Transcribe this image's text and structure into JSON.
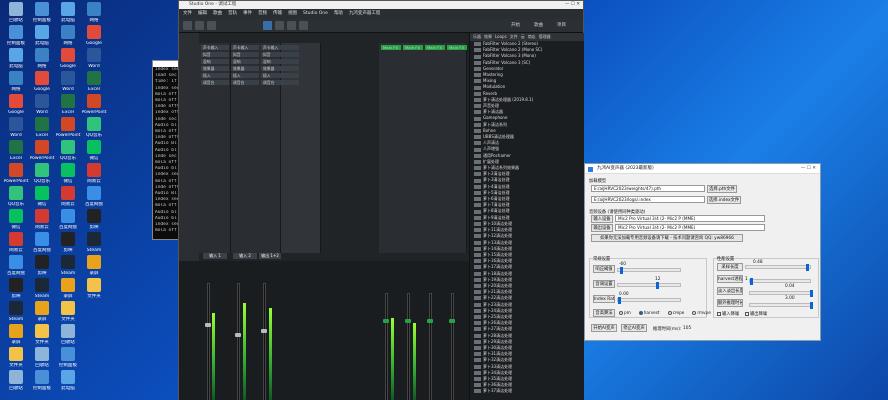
{
  "desktop": {
    "icons": [
      {
        "label": "回收站",
        "color": "#8fb4d9"
      },
      {
        "label": "控制面板",
        "color": "#4a90d9"
      },
      {
        "label": "此电脑",
        "color": "#59a5e6"
      },
      {
        "label": "网络",
        "color": "#3b82c4"
      },
      {
        "label": "Google",
        "color": "#e24a3b"
      },
      {
        "label": "Word",
        "color": "#2b579a"
      },
      {
        "label": "Excel",
        "color": "#217346"
      },
      {
        "label": "PowerPoint",
        "color": "#d24726"
      },
      {
        "label": "QQ音乐",
        "color": "#31c27c"
      },
      {
        "label": "微信",
        "color": "#07c160"
      },
      {
        "label": "网易云",
        "color": "#d33a31"
      },
      {
        "label": "百度网盘",
        "color": "#3a8ee6"
      },
      {
        "label": "剪映",
        "color": "#222222"
      },
      {
        "label": "Steam",
        "color": "#1b2838"
      },
      {
        "label": "录屏",
        "color": "#e8a21c"
      },
      {
        "label": "文件夹",
        "color": "#f3c248"
      }
    ]
  },
  "cmd": {
    "lines": [
      "index sec",
      "load sec",
      "time: 1f",
      "index sec",
      "mola off",
      "mola off",
      "inde offl",
      "index off",
      "inde sec",
      "Audio bl",
      "mola off",
      "inde offl",
      "Audio Bl",
      "Audio bl",
      "inde sec",
      "mola off",
      "Audio bl",
      "index sec",
      "mola off",
      "inde offl",
      "Audio Bl",
      "index sec",
      "mola off",
      "Audio bl",
      "Audio bl",
      "index sec",
      "mola off"
    ]
  },
  "studio": {
    "title": "Studio One - 调试工程",
    "menu": [
      "文件",
      "编辑",
      "歌曲",
      "音轨",
      "事件",
      "音频",
      "传输",
      "视图",
      "Studio One",
      "帮助",
      "九鸿变声器工程"
    ],
    "toolbar_tabs": [
      "开始",
      "歌曲",
      "项目"
    ],
    "left_sends": [
      "声卡输入",
      "拟音",
      "混响",
      "效果器",
      "插入",
      "调音台"
    ],
    "channel_labels": [
      "输入 1",
      "输入 2",
      "输出 1+2"
    ],
    "right_channels": [
      "Main FX",
      "Main FX",
      "Main FX",
      "Main FX"
    ],
    "browser_tabs": [
      "乐器",
      "效果",
      "Loops",
      "文件",
      "云",
      "商店",
      "管理器"
    ],
    "browser_items": [
      "FabFilter Volcano 2 (Stereo)",
      "FabFilter Volcano 2 (Mono SC)",
      "FabFilter Volcano 3 (Mono)",
      "FabFilter Volcano 3 (SC)",
      "Generator",
      "Mastering",
      "Mixing",
      "Modulation",
      "Reverb",
      "萝卜清洁处理器 (2019.8.1)",
      "声音处理",
      "萝卜清洁器",
      "Gamephone",
      "萝卜清洁系列",
      "Bohne",
      "UBBS清洁处理器",
      "人声清洁",
      "人声增强",
      "通用Pochamer",
      "扩展处理",
      "萝卜清洁系列效果器",
      "萝卜2清洁处理",
      "萝卜3清洁处理",
      "萝卜4清洁处理",
      "萝卜5清洁处理",
      "萝卜6清洁处理",
      "萝卜7清洁处理",
      "萝卜8清洁处理",
      "萝卜9清洁处理",
      "萝卜10清洁处理",
      "萝卜11清洁处理",
      "萝卜12清洁处理",
      "萝卜13清洁处理",
      "萝卜14清洁处理",
      "萝卜15清洁处理",
      "萝卜16清洁处理",
      "萝卜17清洁处理",
      "萝卜18清洁处理",
      "萝卜19清洁处理",
      "萝卜20清洁处理",
      "萝卜21清洁处理",
      "萝卜22清洁处理",
      "萝卜23清洁处理",
      "萝卜24清洁处理",
      "萝卜25清洁处理",
      "萝卜26清洁处理",
      "萝卜27清洁处理",
      "萝卜28清洁处理",
      "萝卜29清洁处理",
      "萝卜30清洁处理",
      "萝卜31清洁处理",
      "萝卜32清洁处理",
      "萝卜33清洁处理",
      "萝卜34清洁处理",
      "萝卜35清洁处理",
      "萝卜36清洁处理",
      "萝卜37清洁处理"
    ]
  },
  "dialog": {
    "title": "九鸿AI变声器 (2023最新版)",
    "model_label": "加载模型",
    "pth_path": "E:/aiJHRVC2023/weights/47).pth",
    "index_path": "E:/aiJHRVC2023/logs/.index",
    "pth_button": "选择.pth文件",
    "index_button": "选择.index文件",
    "device_section": "音频设备 (请使用同种类驱动)",
    "input_label": "输入设备",
    "input_value": "Mic2 Pro Virtual 3/4 (2- Mic2 P (MME)",
    "output_label": "输出设备",
    "output_value": "Mic2 Pro Virtual 3/4 (2- Mic2 P (MME)",
    "notice": "如果你无法加载专用音频设备请下载 - 技术问题请咨询 QQ: yw86966",
    "general_label": "常规设置",
    "response_label": "响应阈值",
    "response_value": "-60",
    "pitch_label": "音调设置",
    "pitch_value": "12",
    "index_rate_label": "Index Rate",
    "index_rate_value": "0.00",
    "algo_label": "音高算法",
    "algo_options": [
      "pm",
      "harvest",
      "crepe",
      "rmvpe"
    ],
    "perf_label": "性能设置",
    "sample_len_label": "采样长度",
    "sample_len_value": "0.48",
    "harvest_label": "harvest进程数",
    "harvest_value": "1",
    "fade_label": "淡入淡出长度",
    "fade_value": "0.04",
    "extra_label": "额外推理时长",
    "extra_value": "3.00",
    "denoise_in": "输入降噪",
    "denoise_out": "输出降噪",
    "start_button": "开始AI变声",
    "stop_button": "停止AI变声",
    "latency_label": "推理时间(ms):",
    "latency_value": "105"
  }
}
